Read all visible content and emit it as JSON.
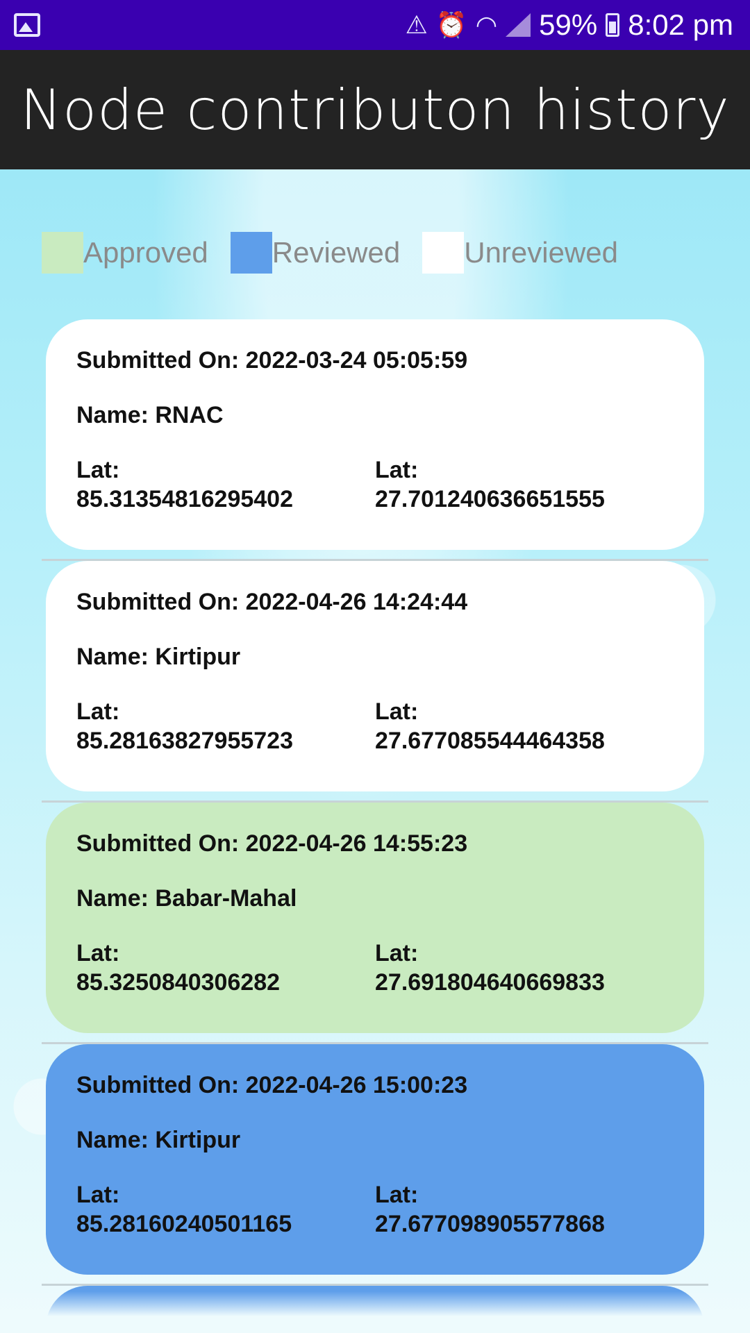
{
  "status_bar": {
    "battery": "59%",
    "time": "8:02 pm",
    "icons": [
      "image-icon",
      "warning-icon",
      "alarm-icon",
      "wifi-icon",
      "signal-icon",
      "battery-icon"
    ]
  },
  "app_bar": {
    "title": "Node contributon history"
  },
  "legend": [
    {
      "label": "Approved",
      "color": "#c9ebc0"
    },
    {
      "label": "Reviewed",
      "color": "#5e9eea"
    },
    {
      "label": "Unreviewed",
      "color": "#ffffff"
    }
  ],
  "records": [
    {
      "status": "unreviewed",
      "submitted": "Submitted On: 2022-03-24 05:05:59",
      "name": "Name: RNAC",
      "lat_label_1": "Lat:",
      "lat_value_1": "85.31354816295402",
      "lat_label_2": "Lat:",
      "lat_value_2": "27.701240636651555"
    },
    {
      "status": "unreviewed",
      "submitted": "Submitted On: 2022-04-26 14:24:44",
      "name": "Name: Kirtipur",
      "lat_label_1": "Lat:",
      "lat_value_1": "85.28163827955723",
      "lat_label_2": "Lat:",
      "lat_value_2": "27.677085544464358"
    },
    {
      "status": "approved",
      "submitted": "Submitted On: 2022-04-26 14:55:23",
      "name": "Name: Babar-Mahal",
      "lat_label_1": "Lat:",
      "lat_value_1": "85.3250840306282",
      "lat_label_2": "Lat:",
      "lat_value_2": "27.691804640669833"
    },
    {
      "status": "reviewed",
      "submitted": "Submitted On: 2022-04-26 15:00:23",
      "name": "Name: Kirtipur",
      "lat_label_1": "Lat:",
      "lat_value_1": "85.28160240501165",
      "lat_label_2": "Lat:",
      "lat_value_2": "27.677098905577868"
    }
  ]
}
